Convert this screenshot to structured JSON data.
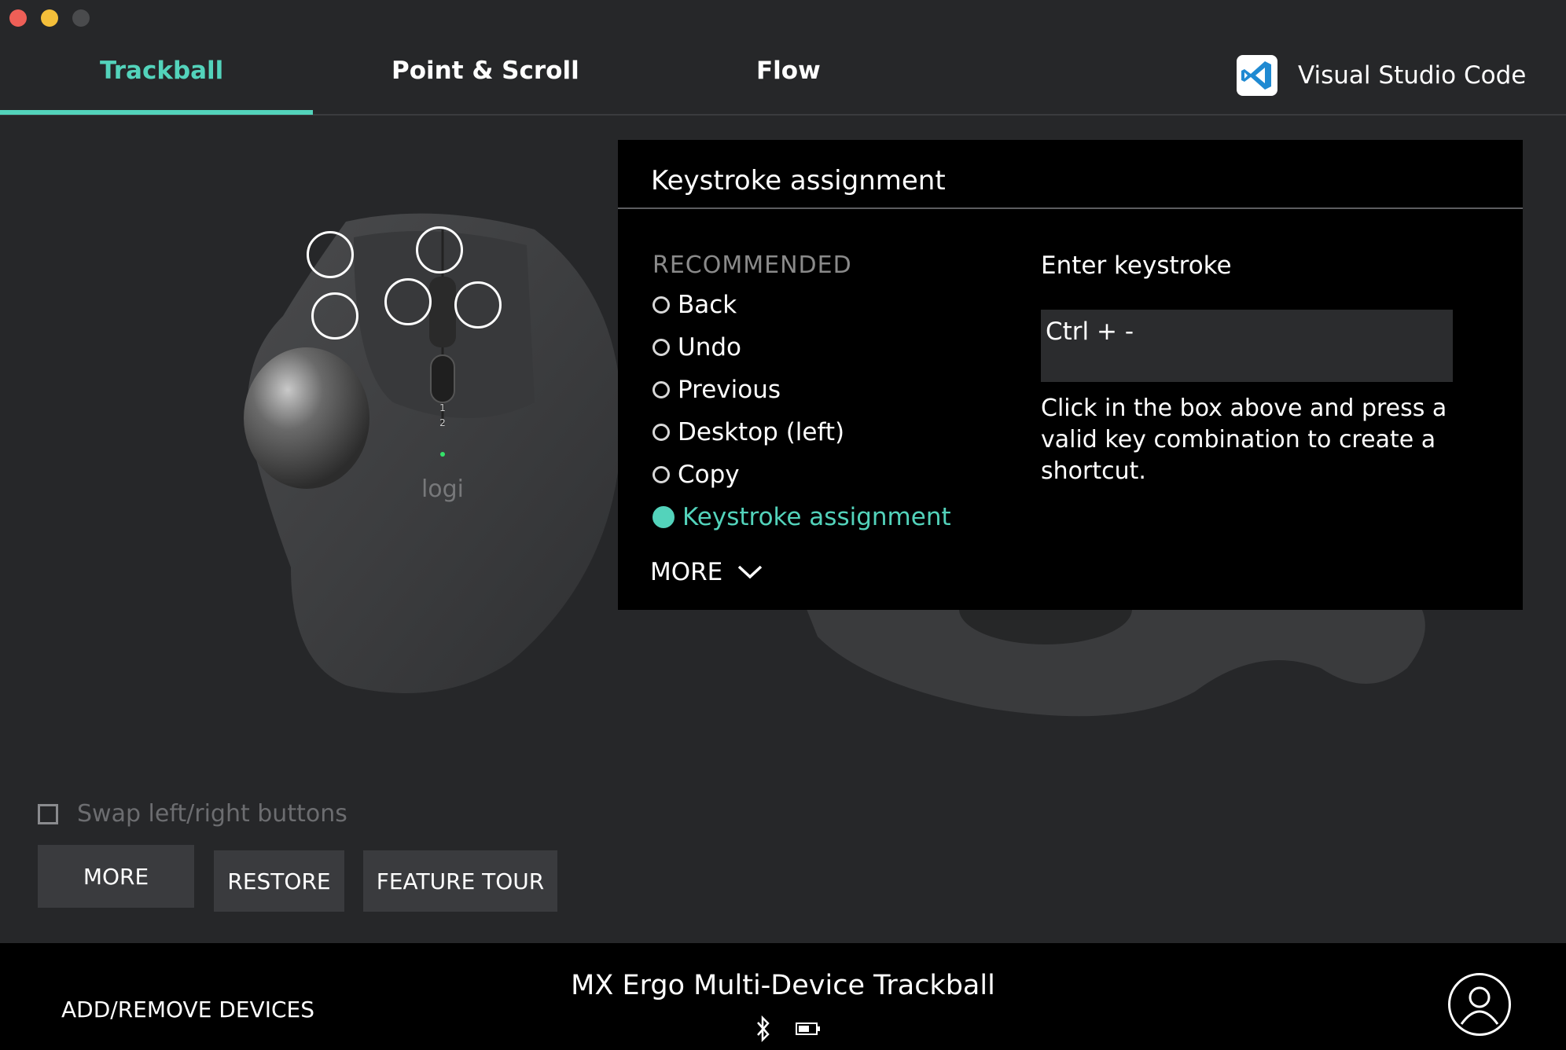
{
  "tabs": [
    {
      "label": "Trackball",
      "active": true
    },
    {
      "label": "Point & Scroll",
      "active": false
    },
    {
      "label": "Flow",
      "active": false
    }
  ],
  "app_profile": {
    "name": "Visual Studio Code",
    "icon": "vscode-icon"
  },
  "device_image": {
    "logo_text": "logi",
    "dpi_labels": [
      "1",
      "2"
    ]
  },
  "panel": {
    "title": "Keystroke assignment",
    "recommended_header": "RECOMMENDED",
    "options": [
      {
        "label": "Back",
        "selected": false
      },
      {
        "label": "Undo",
        "selected": false
      },
      {
        "label": "Previous",
        "selected": false
      },
      {
        "label": "Desktop (left)",
        "selected": false
      },
      {
        "label": "Copy",
        "selected": false
      },
      {
        "label": "Keystroke assignment",
        "selected": true
      }
    ],
    "more_label": "MORE",
    "enter_label": "Enter keystroke",
    "keystroke_value": "Ctrl + -",
    "help_text": "Click in the box above and press a valid key combination to create a shortcut."
  },
  "swap_label": "Swap left/right buttons",
  "buttons": {
    "more": "MORE",
    "restore": "RESTORE",
    "feature_tour": "FEATURE TOUR"
  },
  "footer": {
    "add_remove": "ADD/REMOVE DEVICES",
    "device_name": "MX Ergo Multi-Device Trackball"
  },
  "colors": {
    "accent": "#53d3bb",
    "background": "#262729",
    "panel": "#000000"
  }
}
